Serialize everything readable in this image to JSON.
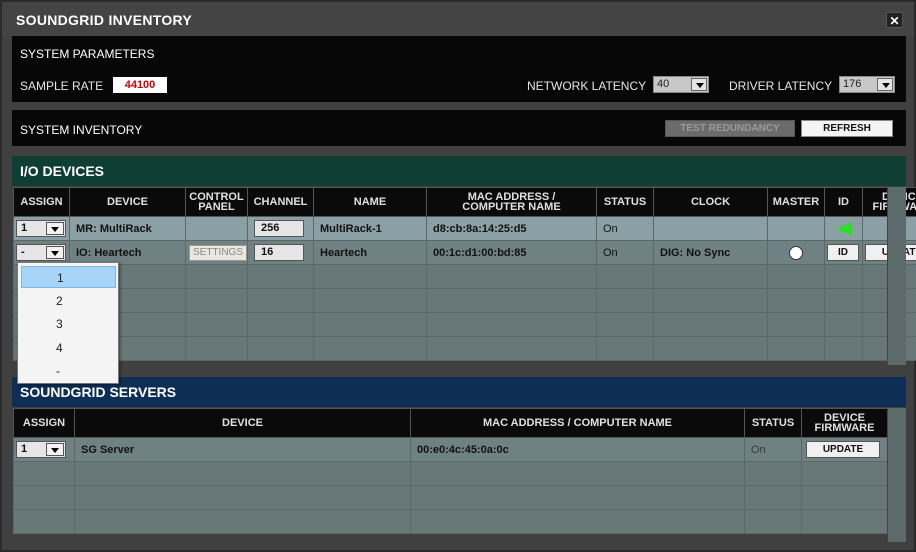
{
  "window": {
    "title": "SOUNDGRID INVENTORY",
    "close_label": "✕"
  },
  "system_parameters": {
    "title": "SYSTEM PARAMETERS",
    "sample_rate_label": "SAMPLE RATE",
    "sample_rate_value": "44100",
    "network_latency_label": "NETWORK LATENCY",
    "network_latency_value": "40",
    "driver_latency_label": "DRIVER LATENCY",
    "driver_latency_value": "176"
  },
  "system_inventory": {
    "title": "SYSTEM INVENTORY",
    "test_redundancy_label": "TEST REDUNDANCY",
    "refresh_label": "REFRESH"
  },
  "io_devices": {
    "title": "I/O DEVICES",
    "columns": {
      "assign": "ASSIGN",
      "device": "DEVICE",
      "control_panel_1": "CONTROL",
      "control_panel_2": "PANEL",
      "channel": "CHANNEL",
      "name": "NAME",
      "mac_1": "MAC ADDRESS /",
      "mac_2": "COMPUTER NAME",
      "status": "STATUS",
      "clock": "CLOCK",
      "master": "MASTER",
      "id": "ID",
      "firmware_1": "DEVICE",
      "firmware_2": "FIRMWARE"
    },
    "rows": [
      {
        "assign": "1",
        "device": "MR: MultiRack",
        "channel": "256",
        "name": "MultiRack-1",
        "mac": "d8:cb:8a:14:25:d5",
        "status": "On",
        "clock": ""
      },
      {
        "assign": "-",
        "device": "IO: Heartech",
        "settings_label": "SETTINGS",
        "channel": "16",
        "name": "Heartech",
        "mac": "00:1c:d1:00:bd:85",
        "status": "On",
        "clock": "DIG: No Sync",
        "id_label": "ID",
        "update_label": "UPDATE"
      }
    ]
  },
  "assign_dropdown": {
    "options": [
      "1",
      "2",
      "3",
      "4",
      "-"
    ],
    "selected": "1"
  },
  "soundgrid_servers": {
    "title": "SOUNDGRID SERVERS",
    "columns": {
      "assign": "ASSIGN",
      "device": "DEVICE",
      "mac": "MAC ADDRESS / COMPUTER NAME",
      "status": "STATUS",
      "firmware_1": "DEVICE",
      "firmware_2": "FIRMWARE"
    },
    "rows": [
      {
        "assign": "1",
        "device": "SG Server",
        "mac": "00:e0:4c:45:0a:0c",
        "status": "On",
        "update_label": "UPDATE"
      }
    ]
  },
  "icons": {
    "id_indicator": "green-triangle-left",
    "master": "radio-circle",
    "close": "x-icon"
  },
  "colors": {
    "io_header": "#0f3f34",
    "servers_header": "#0e2f55",
    "sample_rate_text": "#d00000",
    "id_indicator": "#2ddc2d"
  }
}
